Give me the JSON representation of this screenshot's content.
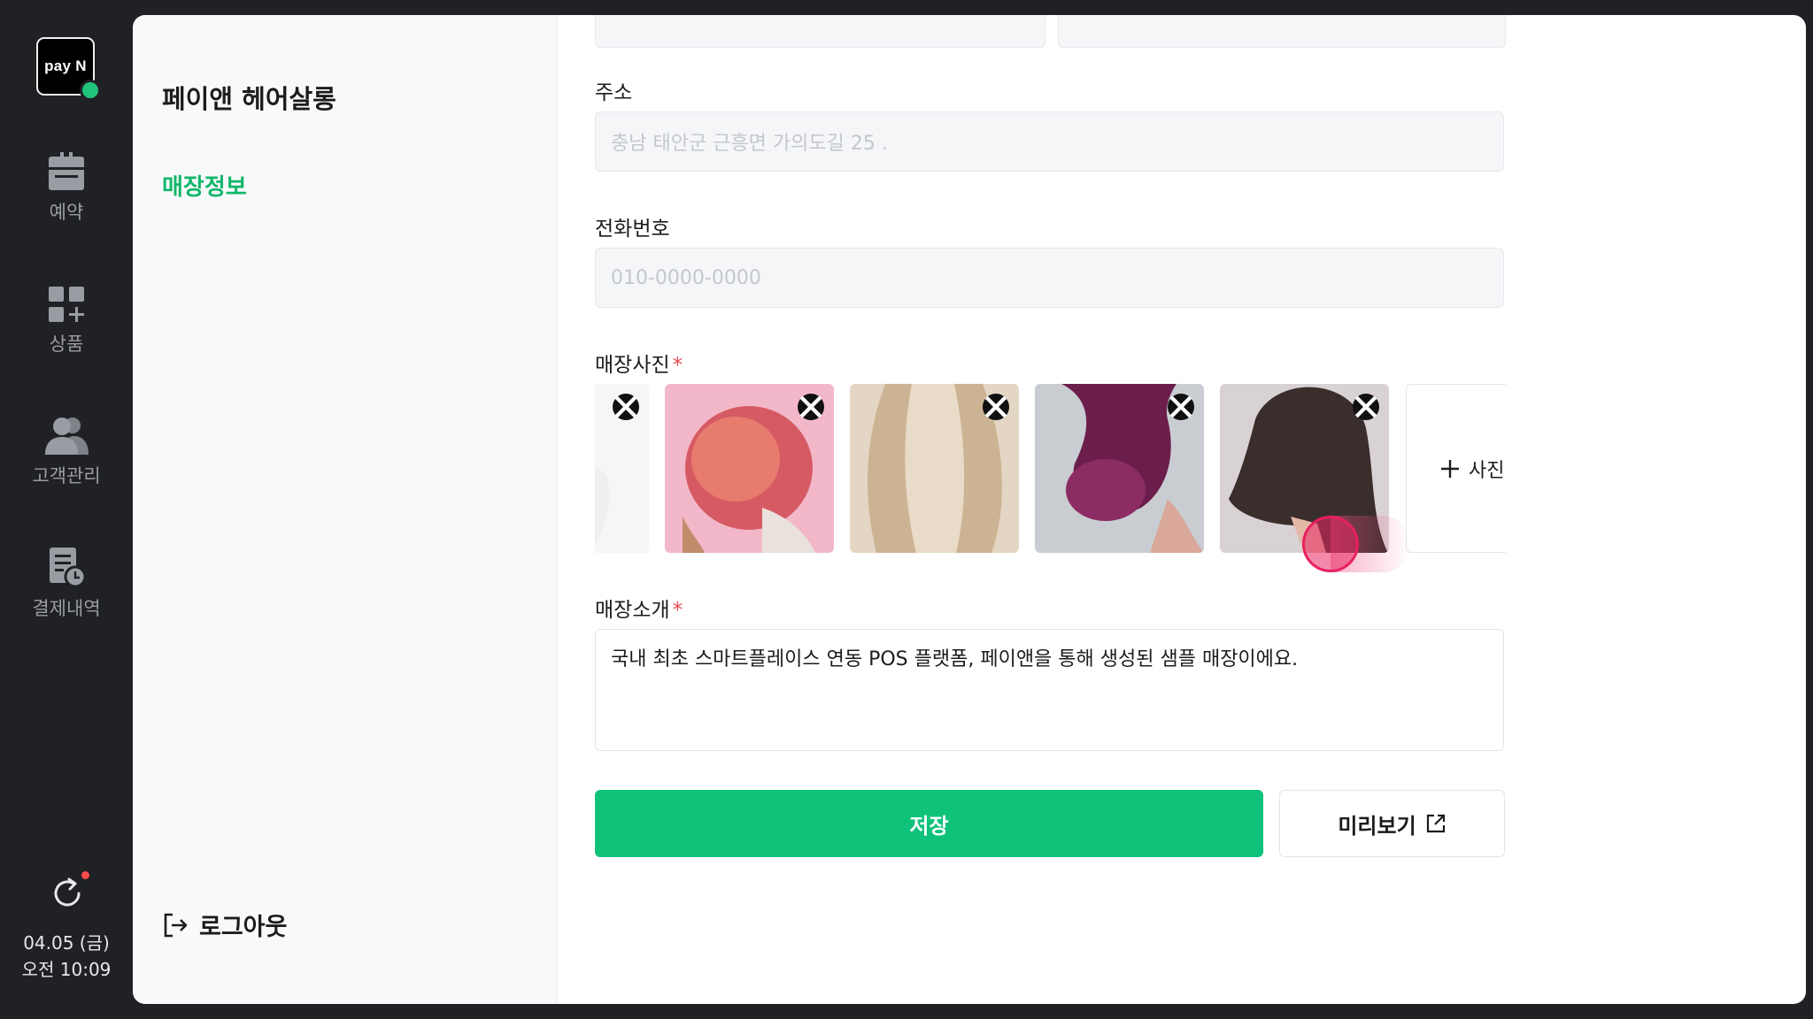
{
  "brand": {
    "logo_text": "pay N",
    "accent": "#12b76a",
    "primary_button": "#0fc27a"
  },
  "nav": [
    {
      "label": "예약",
      "icon": "calendar-icon"
    },
    {
      "label": "상품",
      "icon": "grid-plus-icon"
    },
    {
      "label": "고객관리",
      "icon": "users-icon"
    },
    {
      "label": "결제내역",
      "icon": "receipt-clock-icon"
    }
  ],
  "footer": {
    "date": "04.05 (금)",
    "time": "오전 10:09",
    "refresh_icon": "refresh-icon"
  },
  "sidebar": {
    "store_name": "페이앤 헤어살롱",
    "menu_active": "매장정보",
    "logout": "로그아웃"
  },
  "form": {
    "address": {
      "label": "주소",
      "placeholder": "충남 태안군 근흥면 가의도길 25 ."
    },
    "phone": {
      "label": "전화번호",
      "placeholder": "010-0000-0000"
    },
    "photos": {
      "label": "매장사진",
      "required_mark": "*",
      "add_label": "사진",
      "items": [
        "photo-1",
        "photo-2",
        "photo-3",
        "photo-4",
        "photo-5"
      ]
    },
    "intro": {
      "label": "매장소개",
      "required_mark": "*",
      "value": "국내 최초 스마트플레이스 연동 POS 플랫폼, 페이앤을 통해 생성된 샘플 매장이에요."
    }
  },
  "actions": {
    "save": "저장",
    "preview": "미리보기"
  }
}
